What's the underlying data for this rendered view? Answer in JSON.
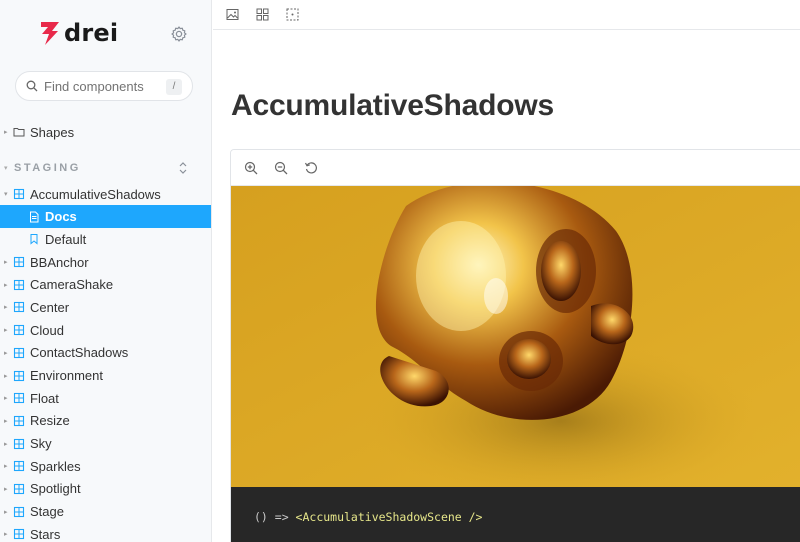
{
  "brand": {
    "name": "drei",
    "accent": "#e8294a"
  },
  "search": {
    "placeholder": "Find components",
    "shortcut": "/"
  },
  "sidebar": {
    "top_item": {
      "label": "Shapes",
      "icon": "folder-icon"
    },
    "section": "STAGING",
    "items": [
      {
        "label": "AccumulativeShadows",
        "icon": "component-icon",
        "expanded": true
      },
      {
        "label": "Docs",
        "icon": "document-icon",
        "child": true,
        "selected": true
      },
      {
        "label": "Default",
        "icon": "bookmark-icon",
        "child": true
      },
      {
        "label": "BBAnchor",
        "icon": "component-icon"
      },
      {
        "label": "CameraShake",
        "icon": "component-icon"
      },
      {
        "label": "Center",
        "icon": "component-icon"
      },
      {
        "label": "Cloud",
        "icon": "component-icon"
      },
      {
        "label": "ContactShadows",
        "icon": "component-icon"
      },
      {
        "label": "Environment",
        "icon": "component-icon"
      },
      {
        "label": "Float",
        "icon": "component-icon"
      },
      {
        "label": "Resize",
        "icon": "component-icon"
      },
      {
        "label": "Sky",
        "icon": "component-icon"
      },
      {
        "label": "Sparkles",
        "icon": "component-icon"
      },
      {
        "label": "Spotlight",
        "icon": "component-icon"
      },
      {
        "label": "Stage",
        "icon": "component-icon"
      },
      {
        "label": "Stars",
        "icon": "component-icon"
      }
    ]
  },
  "page": {
    "title": "AccumulativeShadows"
  },
  "preview": {
    "background": "#d9a521",
    "code_prefix": "() => ",
    "code_tag": "<AccumulativeShadowScene />"
  },
  "colors": {
    "selected": "#1ea7fd",
    "component_icon": "#1ea7fd",
    "code_bg": "#272727"
  }
}
